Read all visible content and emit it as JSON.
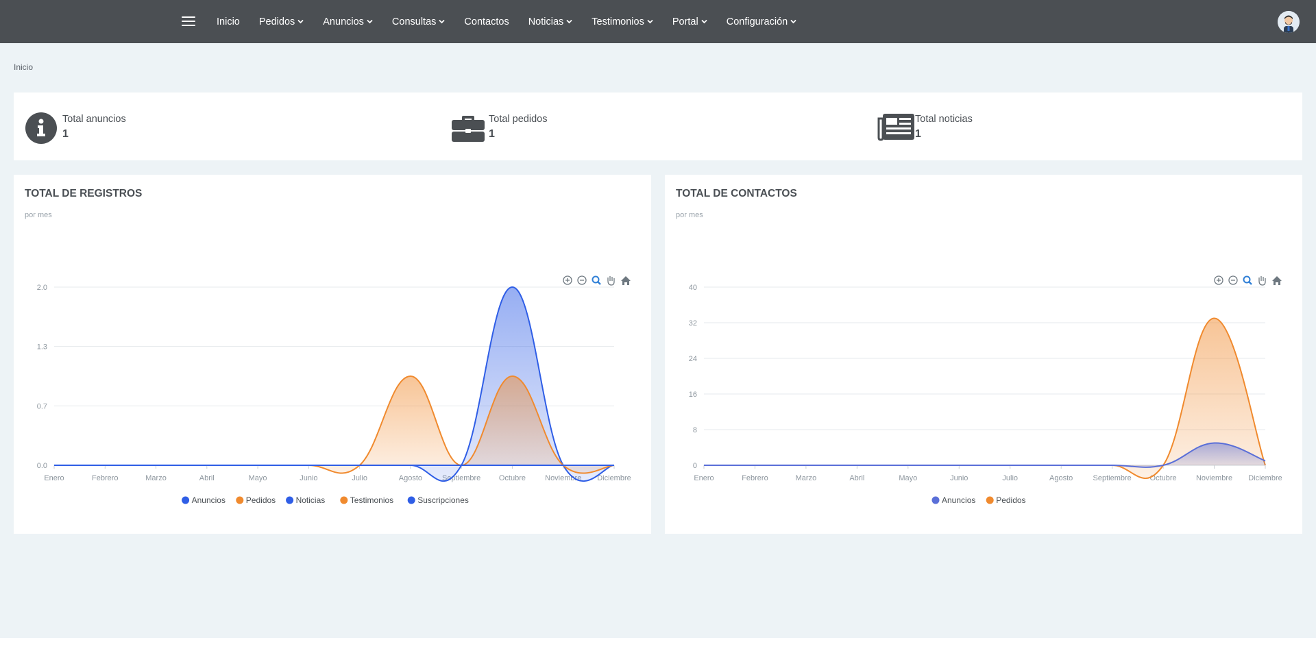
{
  "nav": {
    "items": [
      {
        "label": "Inicio",
        "dropdown": false
      },
      {
        "label": "Pedidos",
        "dropdown": true
      },
      {
        "label": "Anuncios",
        "dropdown": true
      },
      {
        "label": "Consultas",
        "dropdown": true
      },
      {
        "label": "Contactos",
        "dropdown": false
      },
      {
        "label": "Noticias",
        "dropdown": true
      },
      {
        "label": "Testimonios",
        "dropdown": true
      },
      {
        "label": "Portal",
        "dropdown": true
      },
      {
        "label": "Configuración",
        "dropdown": true
      }
    ]
  },
  "breadcrumb": "Inicio",
  "stats": [
    {
      "icon": "info-icon",
      "label": "Total anuncios",
      "value": "1"
    },
    {
      "icon": "briefcase-icon",
      "label": "Total pedidos",
      "value": "1"
    },
    {
      "icon": "newspaper-icon",
      "label": "Total noticias",
      "value": "1"
    }
  ],
  "panels": {
    "registros": {
      "title": "TOTAL DE REGISTROS",
      "subtitle": "por mes"
    },
    "contactos": {
      "title": "TOTAL DE CONTACTOS",
      "subtitle": "por mes"
    }
  },
  "chart_data": [
    {
      "type": "area",
      "title": "TOTAL DE REGISTROS",
      "subtitle": "por mes",
      "categories": [
        "Enero",
        "Febrero",
        "Marzo",
        "Abril",
        "Mayo",
        "Junio",
        "Julio",
        "Agosto",
        "Septiembre",
        "Octubre",
        "Noviembre",
        "Diciembre"
      ],
      "yticks": [
        "0.0",
        "0.7",
        "1.3",
        "2.0"
      ],
      "ylim": [
        0,
        2
      ],
      "legend_position": "bottom",
      "series": [
        {
          "name": "Anuncios",
          "color": "#2f5ee6",
          "values": [
            0,
            0,
            0,
            0,
            0,
            0,
            0,
            0,
            0,
            0,
            0,
            0
          ]
        },
        {
          "name": "Pedidos",
          "color": "#f08a2e",
          "values": [
            0,
            0,
            0,
            0,
            0,
            0,
            0,
            1,
            0,
            1,
            0,
            0
          ]
        },
        {
          "name": "Noticias",
          "color": "#2f5ee6",
          "values": [
            0,
            0,
            0,
            0,
            0,
            0,
            0,
            0,
            0,
            2,
            0,
            0
          ]
        },
        {
          "name": "Testimonios",
          "color": "#f08a2e",
          "values": [
            0,
            0,
            0,
            0,
            0,
            0,
            0,
            0,
            0,
            0,
            0,
            0
          ]
        },
        {
          "name": "Suscripciones",
          "color": "#2f5ee6",
          "values": [
            0,
            0,
            0,
            0,
            0,
            0,
            0,
            0,
            0,
            0,
            0,
            0
          ]
        }
      ],
      "toolbar": [
        "zoom-in-icon",
        "zoom-out-icon",
        "magnifier-icon",
        "pan-hand-icon",
        "home-icon"
      ]
    },
    {
      "type": "area",
      "title": "TOTAL DE CONTACTOS",
      "subtitle": "por mes",
      "categories": [
        "Enero",
        "Febrero",
        "Marzo",
        "Abril",
        "Mayo",
        "Junio",
        "Julio",
        "Agosto",
        "Septiembre",
        "Octubre",
        "Noviembre",
        "Diciembre"
      ],
      "yticks": [
        "0",
        "8",
        "16",
        "24",
        "32",
        "40"
      ],
      "ylim": [
        0,
        40
      ],
      "legend_position": "bottom",
      "series": [
        {
          "name": "Anuncios",
          "color": "#5a6fd8",
          "values": [
            0,
            0,
            0,
            0,
            0,
            0,
            0,
            0,
            0,
            0,
            5,
            1
          ]
        },
        {
          "name": "Pedidos",
          "color": "#f08a2e",
          "values": [
            0,
            0,
            0,
            0,
            0,
            0,
            0,
            0,
            0,
            0,
            33,
            0
          ]
        }
      ],
      "toolbar": [
        "zoom-in-icon",
        "zoom-out-icon",
        "magnifier-icon",
        "pan-hand-icon",
        "home-icon"
      ]
    }
  ]
}
